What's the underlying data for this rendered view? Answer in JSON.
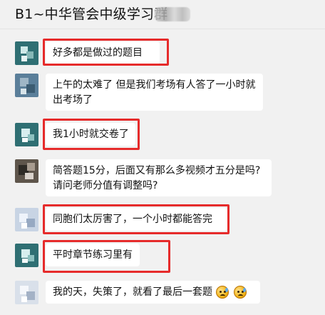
{
  "header": {
    "title": "B1~中华管会中级学习群",
    "member_count_redacted": true
  },
  "messages": [
    {
      "avatar": "avatar-teal",
      "lines": [
        "好多都是做过的题目"
      ],
      "highlighted": true
    },
    {
      "avatar": "avatar-blue",
      "lines": [
        "上午的太难了  但是我们考场有人答了一小时就",
        "出考场了"
      ],
      "highlighted": false
    },
    {
      "avatar": "avatar-teal",
      "lines": [
        "我1小时就交卷了"
      ],
      "highlighted": true
    },
    {
      "avatar": "avatar-dark",
      "lines": [
        "简答题15分，后面又有那么多视频才五分是吗?",
        "请问老师分值有调整吗?"
      ],
      "highlighted": false
    },
    {
      "avatar": "avatar-light",
      "lines": [
        "同胞们太厉害了，一个小时都能答完"
      ],
      "highlighted": true
    },
    {
      "avatar": "avatar-teal",
      "lines": [
        "平时章节练习里有"
      ],
      "highlighted": true
    },
    {
      "avatar": "avatar-pale",
      "lines": [
        "我的天，失策了，就看了最后一套题"
      ],
      "emoji_icons": [
        "sweat-smile-emoji-icon",
        "sweat-smile-emoji-icon"
      ],
      "highlighted": false
    }
  ],
  "colors": {
    "background": "#f1f1f1",
    "bubble": "#ffffff",
    "highlight": "#e62b2b",
    "text": "#111111"
  }
}
